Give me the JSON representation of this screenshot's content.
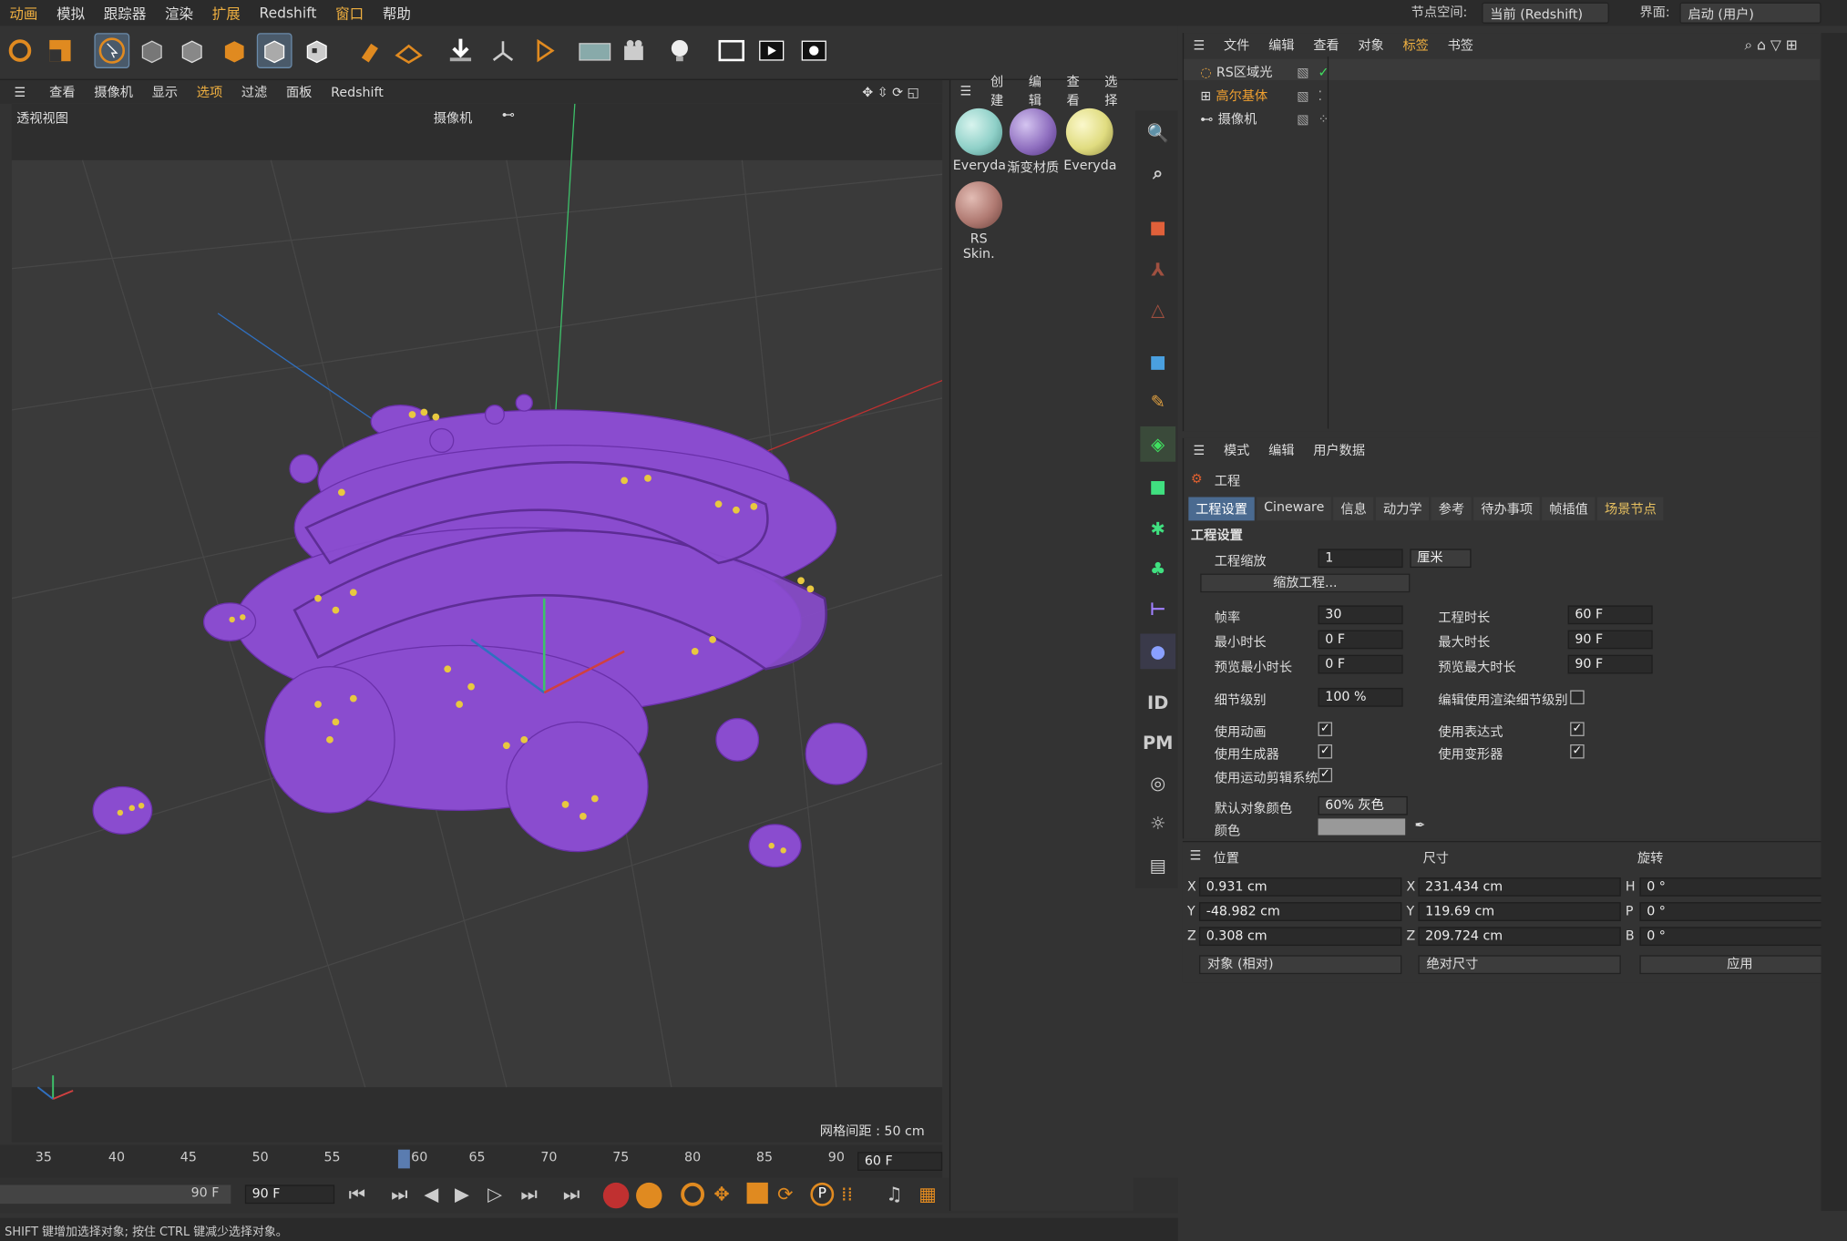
{
  "menu": [
    "动画",
    "模拟",
    "跟踪器",
    "渲染",
    "扩展",
    "Redshift",
    "窗口",
    "帮助"
  ],
  "node_space": {
    "label": "节点空间:",
    "value": "当前 (Redshift)"
  },
  "interface": {
    "label": "界面:",
    "value": "启动 (用户)"
  },
  "viewport_menu": [
    "查看",
    "摄像机",
    "显示",
    "选项",
    "过滤",
    "面板",
    "Redshift"
  ],
  "viewport": {
    "name": "透视视图",
    "camera": "摄像机",
    "grid_spacing": "网格间距 : 50 cm"
  },
  "timeline": {
    "ticks": [
      "35",
      "40",
      "45",
      "50",
      "55",
      "60",
      "65",
      "70",
      "75",
      "80",
      "85",
      "90"
    ],
    "current": "60 F",
    "frame_a": "90 F",
    "frame_b": "90 F"
  },
  "status": "SHIFT 键增加选择对象; 按住 CTRL 键减少选择对象。",
  "materials": {
    "menu": [
      "创建",
      "编辑",
      "查看",
      "选择"
    ],
    "items": [
      {
        "label": "Everyda",
        "color": "#8fd0c8"
      },
      {
        "label": "渐变材质",
        "color": "#9070c0"
      },
      {
        "label": "Everyda",
        "color": "#e0dc80"
      },
      {
        "label": "RS Skin.",
        "color": "#b07a72"
      }
    ]
  },
  "objects": {
    "menu": [
      "文件",
      "编辑",
      "查看",
      "对象",
      "标签",
      "书签"
    ],
    "rows": [
      "RS区域光",
      "高尔基体",
      "摄像机"
    ]
  },
  "attributes": {
    "menu": [
      "模式",
      "编辑",
      "用户数据"
    ],
    "title": "工程",
    "tabs": [
      "工程设置",
      "Cineware",
      "信息",
      "动力学",
      "参考",
      "待办事项",
      "帧插值",
      "场景节点"
    ],
    "section": "工程设置",
    "scale_label": "工程缩放",
    "scale_value": "1",
    "scale_unit": "厘米",
    "scale_button": "缩放工程...",
    "fps_label": "帧率",
    "fps": "30",
    "duration_label": "工程时长",
    "duration": "60 F",
    "min_label": "最小时长",
    "min": "0 F",
    "max_label": "最大时长",
    "max": "90 F",
    "pmin_label": "预览最小时长",
    "pmin": "0 F",
    "pmax_label": "预览最大时长",
    "pmax": "90 F",
    "lod_label": "细节级别",
    "lod": "100 %",
    "render_lod_label": "编辑使用渲染细节级别",
    "anim_label": "使用动画",
    "expr_label": "使用表达式",
    "gen_label": "使用生成器",
    "deform_label": "使用变形器",
    "motion_label": "使用运动剪辑系统",
    "defcolor_label": "默认对象颜色",
    "defcolor": "60% 灰色",
    "color_label": "颜色"
  },
  "coords": {
    "headers": [
      "位置",
      "尺寸",
      "旋转"
    ],
    "rows": [
      {
        "a": "X",
        "pos": "0.931 cm",
        "b": "X",
        "size": "231.434 cm",
        "c": "H",
        "rot": "0 °"
      },
      {
        "a": "Y",
        "pos": "-48.982 cm",
        "b": "Y",
        "size": "119.69 cm",
        "c": "P",
        "rot": "0 °"
      },
      {
        "a": "Z",
        "pos": "0.308 cm",
        "b": "Z",
        "size": "209.724 cm",
        "c": "B",
        "rot": "0 °"
      }
    ],
    "mode": "对象 (相对)",
    "size_mode": "绝对尺寸",
    "apply": "应用"
  },
  "colors": {
    "accent": "#f0b040",
    "object": "#8a4ccf",
    "highlight": "#4a6a90"
  }
}
